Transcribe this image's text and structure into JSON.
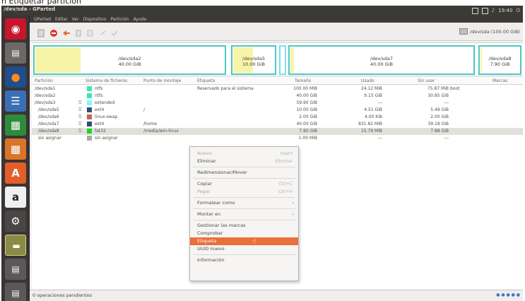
{
  "caption": "n Etiquetar partición",
  "top_panel": {
    "window_title": "/dev/sda - GParted",
    "tray_time": "19:40"
  },
  "menu": [
    "GParted",
    "Editar",
    "Ver",
    "Dispositivo",
    "Partición",
    "Ayuda"
  ],
  "device_selector": {
    "label": "/dev/sda (100.00 GiB)"
  },
  "partition_map": [
    {
      "name": "/dev/sda2",
      "size": "40.00 GiB",
      "kind": "partition"
    },
    {
      "name": "/dev/sda5",
      "size": "10.00 GiB",
      "kind": "logical"
    },
    {
      "name": "/dev/sda7",
      "size": "40.00 GiB",
      "kind": "logical"
    },
    {
      "name": "/dev/sda8",
      "size": "7.90 GiB",
      "kind": "logical"
    }
  ],
  "table": {
    "headers": [
      "Partición",
      "Sistema de ficheros",
      "Punto de montaje",
      "Etiqueta",
      "Tamaño",
      "Usado",
      "Sin usar",
      "Marcas"
    ],
    "rows": [
      {
        "partition": "/dev/sda1",
        "fs": "ntfs",
        "mount": "",
        "label": "Reservado para el sistema",
        "size": "100.00 MiB",
        "used": "24.12 MiB",
        "unused": "75.87 MiB",
        "flags": "boot",
        "color": "#42e5ac",
        "key": false,
        "indent": false
      },
      {
        "partition": "/dev/sda2",
        "fs": "ntfs",
        "mount": "",
        "label": "",
        "size": "40.00 GiB",
        "used": "9.15 GiB",
        "unused": "30.85 GiB",
        "flags": "",
        "color": "#42e5ac",
        "key": false,
        "indent": false
      },
      {
        "partition": "/dev/sda3",
        "fs": "extended",
        "mount": "",
        "label": "",
        "size": "59.90 GiB",
        "used": "---",
        "unused": "---",
        "flags": "",
        "color": "#7dfcfe",
        "key": true,
        "indent": false
      },
      {
        "partition": "/dev/sda5",
        "fs": "ext4",
        "mount": "/",
        "label": "",
        "size": "10.00 GiB",
        "used": "4.51 GiB",
        "unused": "5.49 GiB",
        "flags": "",
        "color": "#314e78",
        "key": true,
        "indent": true
      },
      {
        "partition": "/dev/sda6",
        "fs": "linux-swap",
        "mount": "",
        "label": "",
        "size": "2.00 GiB",
        "used": "4.00 KiB",
        "unused": "2.00 GiB",
        "flags": "",
        "color": "#c1665a",
        "key": true,
        "indent": true
      },
      {
        "partition": "/dev/sda7",
        "fs": "ext4",
        "mount": "/home",
        "label": "",
        "size": "40.00 GiB",
        "used": "831.82 MiB",
        "unused": "39.18 GiB",
        "flags": "",
        "color": "#314e78",
        "key": true,
        "indent": true
      },
      {
        "partition": "/dev/sda8",
        "fs": "fat32",
        "mount": "/media/win-linux",
        "label": "",
        "size": "7.90 GiB",
        "used": "15.79 MiB",
        "unused": "7.88 GiB",
        "flags": "",
        "color": "#18d918",
        "key": true,
        "indent": true,
        "selected": true
      },
      {
        "partition": "sin asignar",
        "fs": "sin asignar",
        "mount": "",
        "label": "",
        "size": "1.00 MiB",
        "used": "---",
        "unused": "---",
        "flags": "",
        "color": "#a9a9a9",
        "key": false,
        "indent": true
      }
    ]
  },
  "context_menu": {
    "items": [
      {
        "label": "Nuevo",
        "accel": "Insert",
        "disabled": true
      },
      {
        "label": "Eliminar",
        "accel": "Eliminar",
        "disabled": false
      },
      {
        "sep": true
      },
      {
        "label": "Redimensionar/Mover",
        "disabled": false
      },
      {
        "sep": true
      },
      {
        "label": "Copiar",
        "accel": "Ctrl+C",
        "disabled": false
      },
      {
        "label": "Pegar",
        "accel": "Ctrl+V",
        "disabled": true
      },
      {
        "sep": true
      },
      {
        "label": "Formatear como",
        "submenu": true,
        "disabled": false
      },
      {
        "sep": true
      },
      {
        "label": "Montar en",
        "submenu": true,
        "disabled": false
      },
      {
        "sep": true
      },
      {
        "label": "Gestionar las marcas",
        "disabled": false
      },
      {
        "label": "Comprobar",
        "disabled": false
      },
      {
        "label": "Etiqueta",
        "disabled": false,
        "highlighted": true
      },
      {
        "label": "UUID nuevo",
        "disabled": false
      },
      {
        "sep": true
      },
      {
        "label": "Información",
        "disabled": false
      }
    ]
  },
  "status": {
    "text": "0 operaciones pendientes"
  },
  "colors": {
    "panel": "#3b3a36",
    "launcher": "#3a3435",
    "accent": "#e9703a",
    "partition_border": "#4dc7c3",
    "used_fill": "#f7f4a8"
  },
  "launcher_icons": [
    "ubuntu-dash-icon",
    "files-icon",
    "firefox-icon",
    "writer-icon",
    "calc-icon",
    "impress-icon",
    "software-center-icon",
    "amazon-icon",
    "settings-icon",
    "gparted-icon",
    "disk-icon",
    "disk-icon",
    "trash-icon"
  ]
}
